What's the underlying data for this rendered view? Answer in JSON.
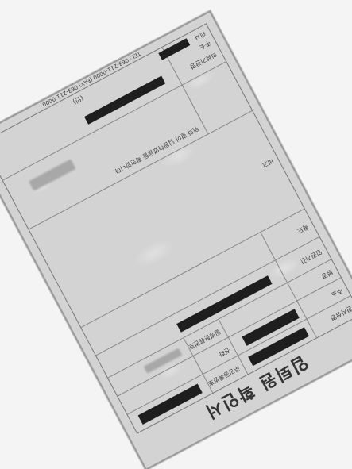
{
  "document": {
    "title": "입퇴원 확인서",
    "fields": {
      "patient_name": "환자성명",
      "resident_no": "주민등록번호",
      "address": "주소",
      "phone": "전화",
      "disease_name": "병명",
      "disease_code": "질병분류번호",
      "admission_period": "입원기간",
      "purpose": "용도",
      "remarks": "비고",
      "hospital_name": "의료기관명",
      "hospital_address": "주소",
      "doctor": "의사",
      "stamp_label": "(인)"
    },
    "statement": "위와 같이 입원하였음을 확인합니다.",
    "footer_phone": "TEL: 063-211-0000 (FAX) 063-211-0000"
  }
}
